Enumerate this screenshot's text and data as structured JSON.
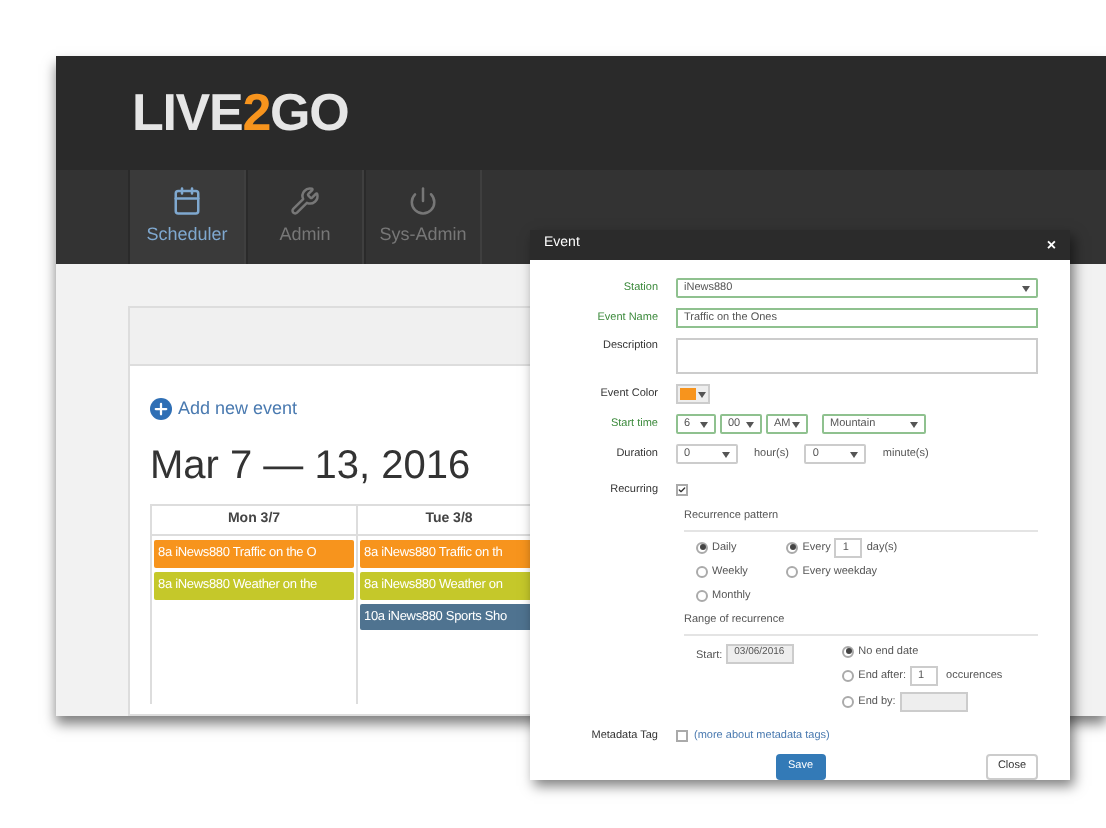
{
  "logo": [
    "LIVE",
    "2",
    "GO"
  ],
  "nav": [
    {
      "label": "Scheduler",
      "selected": true
    },
    {
      "label": "Admin",
      "selected": false
    },
    {
      "label": "Sys-Admin",
      "selected": false
    }
  ],
  "add_event": "Add new event",
  "week_title": "Mar 7 — 13, 2016",
  "days": [
    {
      "label": "Mon 3/7",
      "events": [
        {
          "time": "8a",
          "text": "iNews880 Traffic on the O",
          "color": "#f7941d"
        },
        {
          "time": "8a",
          "text": "iNews880 Weather on the",
          "color": "#c5c82a"
        }
      ]
    },
    {
      "label": "Tue 3/8",
      "events": [
        {
          "time": "8a",
          "text": "iNews880 Traffic on th",
          "color": "#f7941d"
        },
        {
          "time": "8a",
          "text": "iNews880 Weather on",
          "color": "#c5c82a"
        },
        {
          "time": "10a",
          "text": "iNews880 Sports Sho",
          "color": "#4f7390"
        }
      ]
    }
  ],
  "modal": {
    "title": "Event",
    "close": "×",
    "station": {
      "label": "Station",
      "value": "iNews880",
      "valid": true
    },
    "event_name": {
      "label": "Event Name",
      "value": "Traffic on the Ones",
      "valid": true
    },
    "description": {
      "label": "Description",
      "valid": false
    },
    "event_color": {
      "label": "Event Color",
      "color": "#f7941d"
    },
    "start_time": {
      "label": "Start time",
      "valid": true,
      "hour": "6",
      "minute": "00",
      "ampm": "AM",
      "zone": "Mountain"
    },
    "duration": {
      "label": "Duration",
      "valid": false,
      "hours": "0",
      "hours_unit": "hour(s)",
      "minutes": "0",
      "minutes_unit": "minute(s)"
    },
    "recurring": {
      "label": "Recurring",
      "checked": true
    },
    "pattern": {
      "heading": "Recurrence pattern",
      "options": [
        {
          "label": "Daily",
          "selected": true
        },
        {
          "label": "Weekly",
          "selected": false
        },
        {
          "label": "Monthly",
          "selected": false
        }
      ],
      "every": {
        "label": "Every",
        "value": "1",
        "unit": "day(s)",
        "selected": true
      },
      "weekday": {
        "label": "Every weekday",
        "selected": false
      }
    },
    "range": {
      "heading": "Range of recurrence",
      "start_label": "Start:",
      "start_value": "03/06/2016",
      "no_end": {
        "label": "No end date",
        "selected": true
      },
      "end_after": {
        "label": "End after:",
        "value": "1",
        "unit": "occurences",
        "selected": false
      },
      "end_by": {
        "label": "End by:",
        "selected": false
      }
    },
    "metadata": {
      "label": "Metadata Tag",
      "checked": false,
      "link": "(more about metadata tags)"
    },
    "save": "Save",
    "close_button": "Close"
  }
}
